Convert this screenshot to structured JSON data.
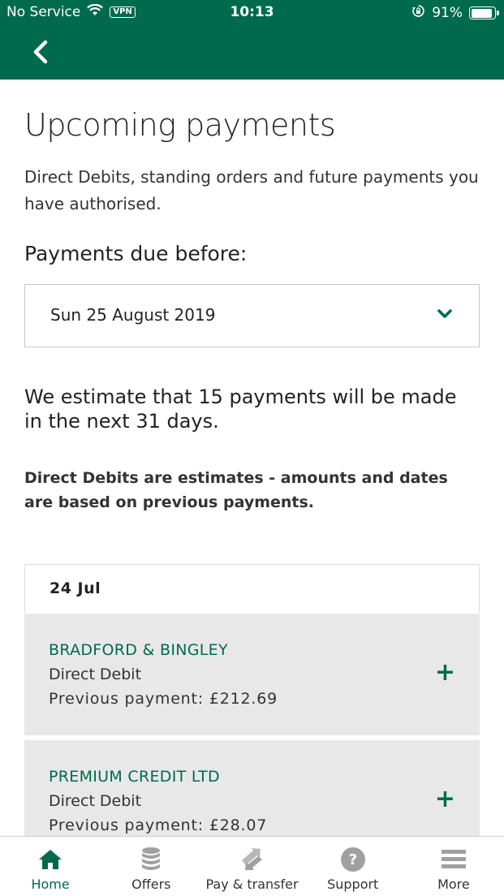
{
  "status_bar": {
    "carrier": "No Service",
    "vpn": "VPN",
    "time": "10:13",
    "battery": "91%",
    "battery_level": 0.91
  },
  "page": {
    "title": "Upcoming payments",
    "subtitle": "Direct Debits, standing orders and future payments you have authorised.",
    "due_label": "Payments due before:",
    "due_date": "Sun 25 August 2019",
    "estimate": "We estimate that 15 payments will be made in the next 31 days.",
    "note": "Direct Debits are estimates - amounts and dates are based on previous payments."
  },
  "payments_group": {
    "date": "24 Jul",
    "items": [
      {
        "payee": "BRADFORD & BINGLEY",
        "type": "Direct Debit",
        "previous": "Previous payment: £212.69"
      },
      {
        "payee": "PREMIUM CREDIT LTD",
        "type": "Direct Debit",
        "previous": "Previous payment: £28.07"
      }
    ]
  },
  "tabs": [
    {
      "label": "Home",
      "icon": "home-icon",
      "active": true
    },
    {
      "label": "Offers",
      "icon": "coins-icon",
      "active": false
    },
    {
      "label": "Pay & transfer",
      "icon": "transfer-icon",
      "active": false
    },
    {
      "label": "Support",
      "icon": "help-icon",
      "active": false
    },
    {
      "label": "More",
      "icon": "menu-icon",
      "active": false
    }
  ],
  "colors": {
    "brand": "#006a4d",
    "card_background": "#e8e8e8",
    "inactive_icon": "#a0a0a0"
  }
}
